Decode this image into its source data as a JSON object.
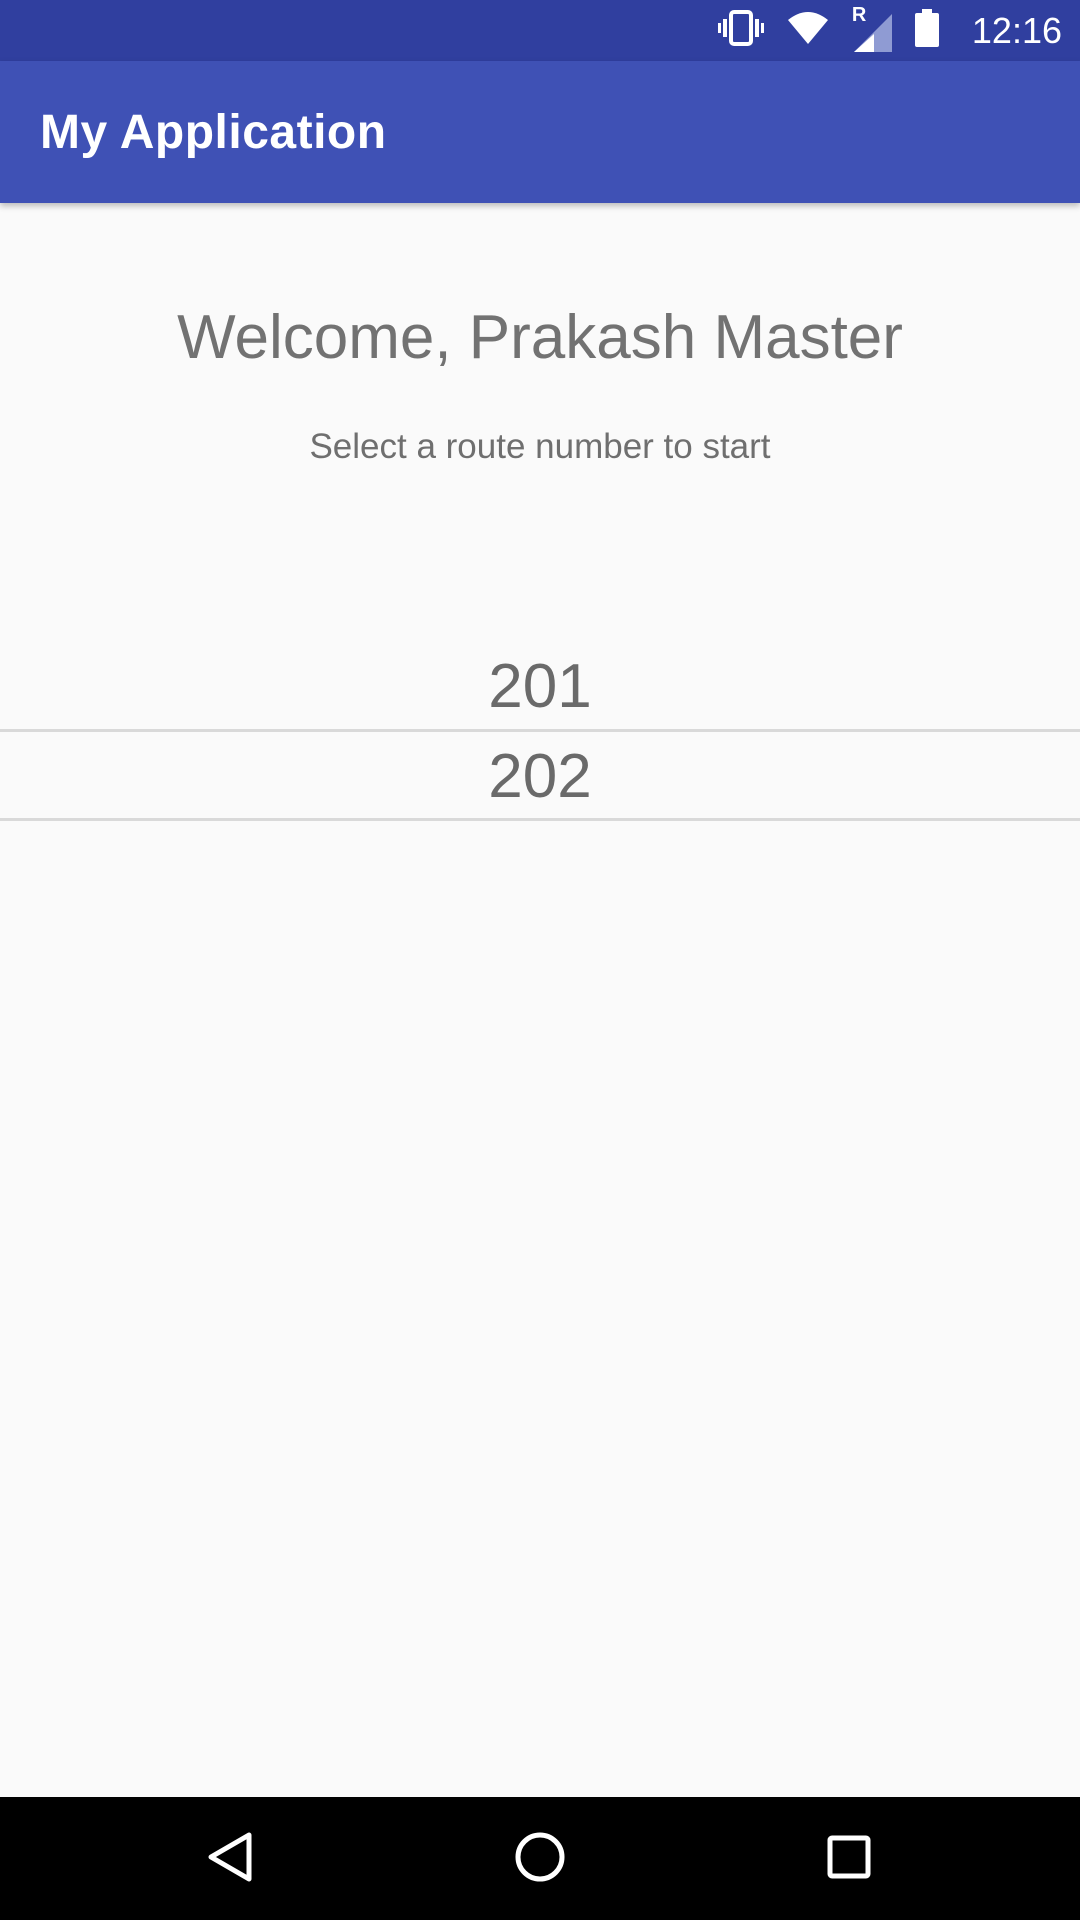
{
  "status_bar": {
    "time": "12:16",
    "roaming_indicator": "R",
    "icons": [
      "vibrate-icon",
      "wifi-icon",
      "cell-signal-icon",
      "battery-icon"
    ],
    "background": "#303f9f"
  },
  "app_bar": {
    "title": "My Application",
    "background": "#3f51b5"
  },
  "main": {
    "welcome_text": "Welcome, Prakash Master",
    "subtitle": "Select a route number to start",
    "route_picker": {
      "items": [
        "201",
        "202"
      ],
      "selected": "202"
    }
  },
  "nav_bar": {
    "icons": [
      "back-icon",
      "home-icon",
      "recents-icon"
    ]
  }
}
